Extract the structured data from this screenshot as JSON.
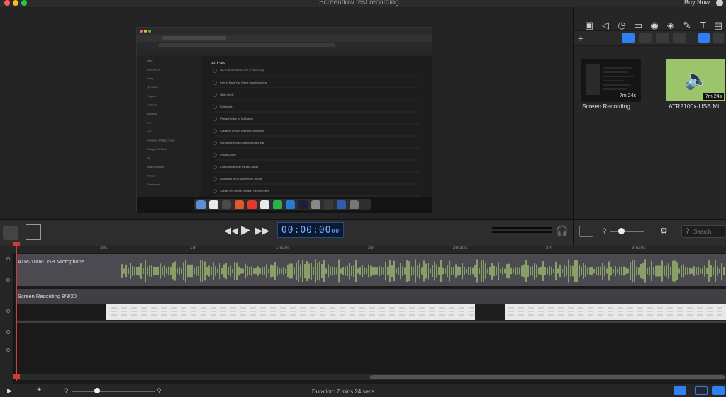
{
  "window": {
    "title": "Screenflow test recording",
    "buy_now": "Buy Now"
  },
  "preview": {
    "content": "recorded browser screen (Todoist)",
    "page_header": "Articles",
    "sidebar_items": [
      "Inbox",
      "Team Inbox",
      "Today",
      "Upcoming",
      "Projects",
      "Personal",
      "Business",
      "ICS",
      "MCIT",
      "Freelance Writing Course",
      "College Info Desk",
      "Etc.",
      "Tags Upcoming",
      "Articles",
      "Checkpoints"
    ],
    "tasks": [
      "BLOG POST TEMPLATE (COPY THIS)",
      "How to Make Your Phone Less Distracting",
      "Write Article",
      "Edit Article",
      "Prepare Article for Publication",
      "Create all relevant links and thumbnails",
      "Run article through Grammarly and edit",
      "Publish Article",
      "Link to article in all relevant places",
      "Add target link to Article Rank Tracker",
      "Create Text Overlay Images - Pin and Share"
    ]
  },
  "media_library": {
    "items": [
      {
        "label": "Screen Recording...",
        "duration": "7m 24s",
        "kind": "video"
      },
      {
        "label": "ATR2100x-USB Mi...",
        "duration": "7m 24s",
        "kind": "audio"
      }
    ],
    "search_placeholder": "Search"
  },
  "transport": {
    "timecode": "00:00:00",
    "timecode_frames": "00"
  },
  "ruler": {
    "ticks": [
      "30s",
      "1m",
      "1m30s",
      "2m",
      "2m30s",
      "3m",
      "3m30s"
    ]
  },
  "tracks": [
    {
      "name": "ATR2100x-USB Microphone",
      "kind": "audio"
    },
    {
      "name": "Screen Recording 8/3/20",
      "kind": "video"
    }
  ],
  "status": {
    "duration": "Duration: 7 mins 24 secs"
  },
  "colors": {
    "accent": "#2f7ff5",
    "playhead": "#d43a3a",
    "waveform": "#b5d67a",
    "audio_thumb": "#9cc46b"
  },
  "icons": [
    "screen-record-icon",
    "audio-icon",
    "clock-icon",
    "monitor-icon",
    "callout-icon",
    "filter-icon",
    "annotation-icon",
    "text-icon",
    "library-icon"
  ]
}
